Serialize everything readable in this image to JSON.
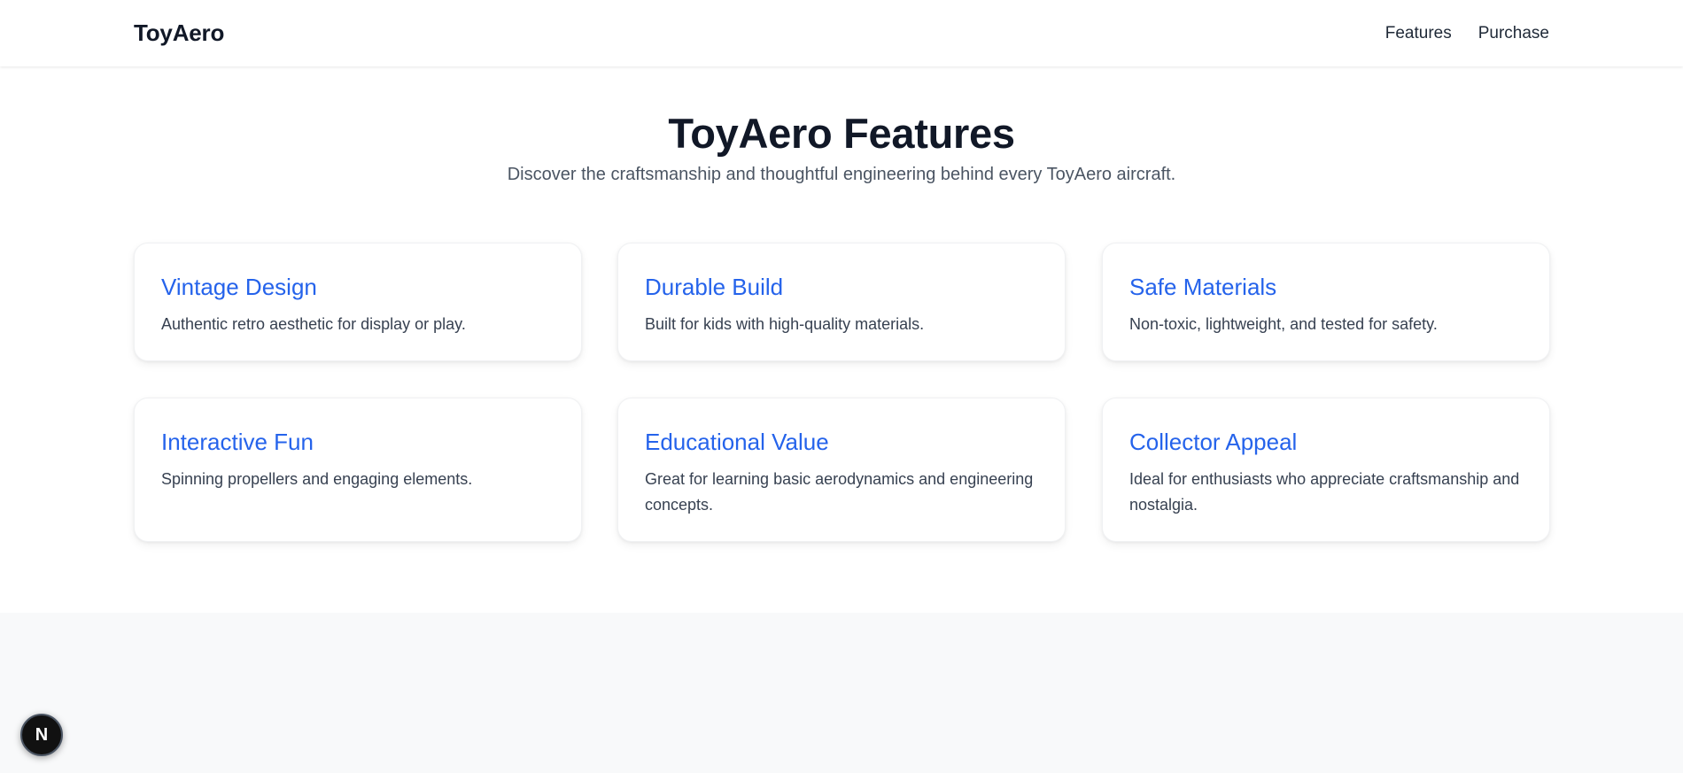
{
  "navbar": {
    "brand": "ToyAero",
    "links": [
      {
        "label": "Features"
      },
      {
        "label": "Purchase"
      }
    ]
  },
  "features": {
    "title": "ToyAero Features",
    "subtitle": "Discover the craftsmanship and thoughtful engineering behind every ToyAero aircraft.",
    "cards": [
      {
        "title": "Vintage Design",
        "description": "Authentic retro aesthetic for display or play."
      },
      {
        "title": "Durable Build",
        "description": "Built for kids with high-quality materials."
      },
      {
        "title": "Safe Materials",
        "description": "Non-toxic, lightweight, and tested for safety."
      },
      {
        "title": "Interactive Fun",
        "description": "Spinning propellers and engaging elements."
      },
      {
        "title": "Educational Value",
        "description": "Great for learning basic aerodynamics and engineering concepts."
      },
      {
        "title": "Collector Appeal",
        "description": "Ideal for enthusiasts who appreciate craftsmanship and nostalgia."
      }
    ]
  },
  "dev_badge": {
    "letter": "N",
    "icon": "nextjs-logo-icon"
  },
  "colors": {
    "accent": "#2563eb",
    "heading": "#111827",
    "body_text": "#374151",
    "lower_section_bg": "#f8f9fa"
  }
}
